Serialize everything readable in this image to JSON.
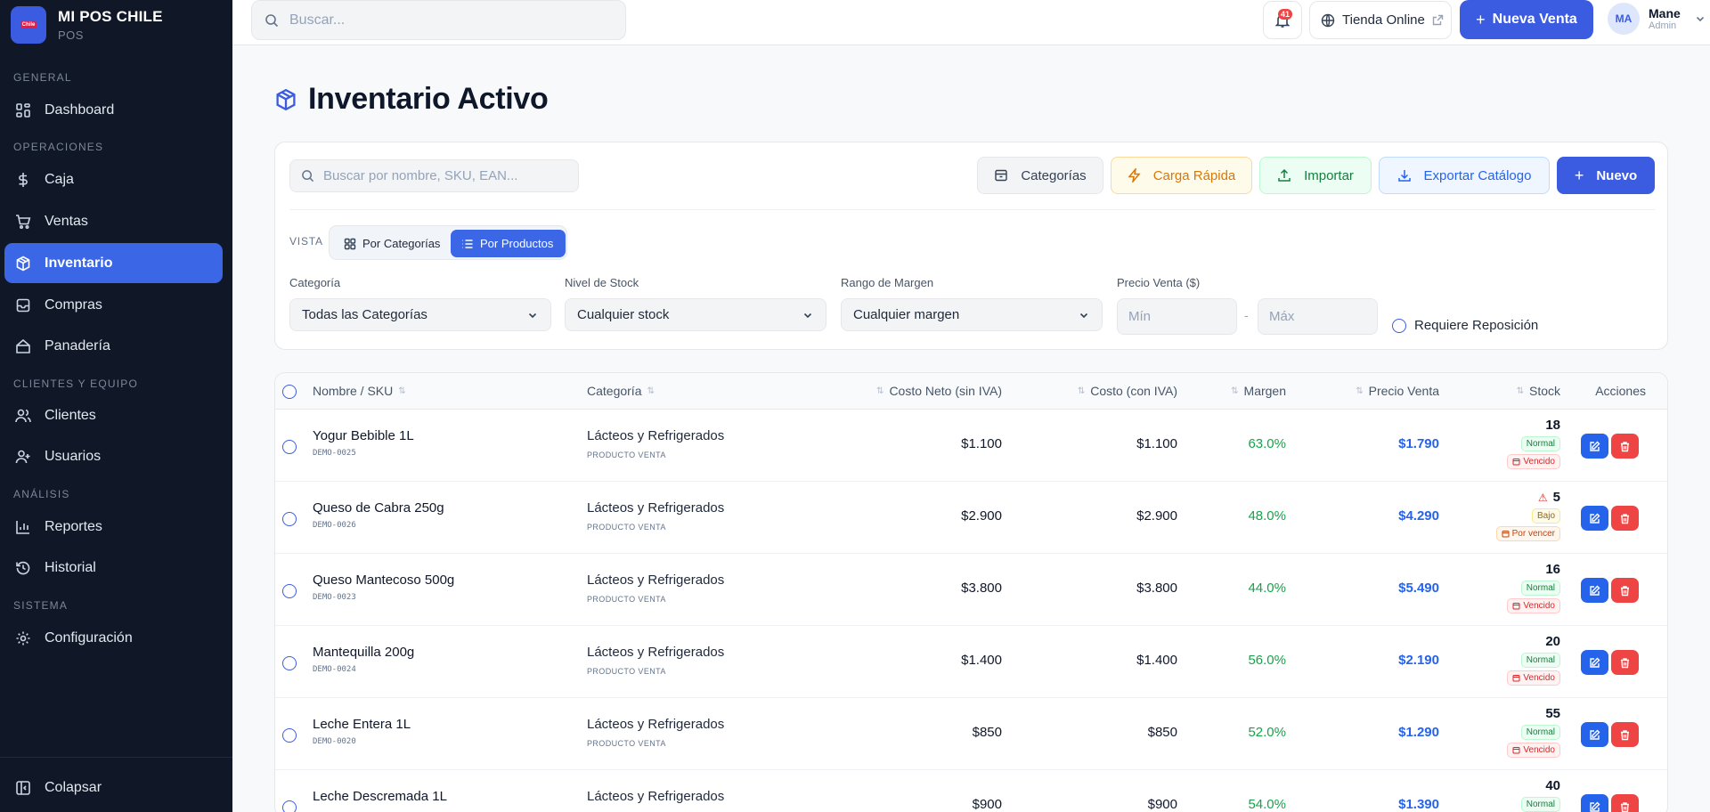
{
  "app": {
    "name": "MI POS CHILE",
    "subtitle": "POS",
    "logo_badge": "Chile"
  },
  "sidebar": {
    "sections": [
      {
        "label": "GENERAL"
      },
      {
        "label": "OPERACIONES"
      },
      {
        "label": "CLIENTES Y EQUIPO"
      },
      {
        "label": "ANÁLISIS"
      },
      {
        "label": "SISTEMA"
      }
    ],
    "items": [
      {
        "label": "Dashboard",
        "icon": "grid-icon"
      },
      {
        "label": "Caja",
        "icon": "dollar-icon"
      },
      {
        "label": "Ventas",
        "icon": "cart-icon"
      },
      {
        "label": "Inventario",
        "icon": "box-icon",
        "active": true
      },
      {
        "label": "Compras",
        "icon": "receipt-icon"
      },
      {
        "label": "Panadería",
        "icon": "home-icon"
      },
      {
        "label": "Clientes",
        "icon": "users-icon"
      },
      {
        "label": "Usuarios",
        "icon": "user-icon"
      },
      {
        "label": "Reportes",
        "icon": "bar-chart-icon"
      },
      {
        "label": "Historial",
        "icon": "history-icon"
      },
      {
        "label": "Configuración",
        "icon": "gear-icon"
      }
    ],
    "collapse_label": "Colapsar"
  },
  "topbar": {
    "search_placeholder": "Buscar...",
    "notification_count": "41",
    "store_label": "Tienda Online",
    "new_sale_label": "Nueva Venta",
    "user": {
      "initials": "MA",
      "name": "Mane",
      "role": "Admin"
    }
  },
  "page": {
    "title": "Inventario Activo"
  },
  "toolbar": {
    "search_placeholder": "Buscar por nombre, SKU, EAN...",
    "categories_label": "Categorías",
    "quick_load_label": "Carga Rápida",
    "import_label": "Importar",
    "export_label": "Exportar Catálogo",
    "new_label": "Nuevo"
  },
  "view": {
    "label": "VISTA",
    "by_categories": "Por Categorías",
    "by_products": "Por Productos",
    "selected": "Por Productos"
  },
  "filters": {
    "category": {
      "label": "Categoría",
      "value": "Todas las Categorías"
    },
    "stock_level": {
      "label": "Nivel de Stock",
      "value": "Cualquier stock"
    },
    "margin_range": {
      "label": "Rango de Margen",
      "value": "Cualquier margen"
    },
    "price": {
      "label": "Precio Venta ($)",
      "min_placeholder": "Mín",
      "max_placeholder": "Máx",
      "separator": "-"
    },
    "restock_label": "Requiere Reposición"
  },
  "table": {
    "columns": [
      "Nombre / SKU",
      "Categoría",
      "Costo Neto (sin IVA)",
      "Costo (con IVA)",
      "Margen",
      "Precio Venta",
      "Stock",
      "Acciones"
    ],
    "rows": [
      {
        "name": "Yogur Bebible 1L",
        "sku": "DEMO-0025",
        "category": "Lácteos y Refrigerados",
        "type": "PRODUCTO VENTA",
        "cost_net": "$1.100",
        "cost_iva": "$1.100",
        "margin": "63.0%",
        "price": "$1.790",
        "stock": "18",
        "level": "Normal",
        "expiry": "Vencido",
        "warn": ""
      },
      {
        "name": "Queso de Cabra 250g",
        "sku": "DEMO-0026",
        "category": "Lácteos y Refrigerados",
        "type": "PRODUCTO VENTA",
        "cost_net": "$2.900",
        "cost_iva": "$2.900",
        "margin": "48.0%",
        "price": "$4.290",
        "stock": "5",
        "level": "Bajo",
        "expiry": "Por vencer",
        "warn": "⚠"
      },
      {
        "name": "Queso Mantecoso 500g",
        "sku": "DEMO-0023",
        "category": "Lácteos y Refrigerados",
        "type": "PRODUCTO VENTA",
        "cost_net": "$3.800",
        "cost_iva": "$3.800",
        "margin": "44.0%",
        "price": "$5.490",
        "stock": "16",
        "level": "Normal",
        "expiry": "Vencido",
        "warn": ""
      },
      {
        "name": "Mantequilla 200g",
        "sku": "DEMO-0024",
        "category": "Lácteos y Refrigerados",
        "type": "PRODUCTO VENTA",
        "cost_net": "$1.400",
        "cost_iva": "$1.400",
        "margin": "56.0%",
        "price": "$2.190",
        "stock": "20",
        "level": "Normal",
        "expiry": "Vencido",
        "warn": ""
      },
      {
        "name": "Leche Entera 1L",
        "sku": "DEMO-0020",
        "category": "Lácteos y Refrigerados",
        "type": "PRODUCTO VENTA",
        "cost_net": "$850",
        "cost_iva": "$850",
        "margin": "52.0%",
        "price": "$1.290",
        "stock": "55",
        "level": "Normal",
        "expiry": "Vencido",
        "warn": ""
      },
      {
        "name": "Leche Descremada 1L",
        "sku": "",
        "category": "Lácteos y Refrigerados",
        "type": "",
        "cost_net": "$900",
        "cost_iva": "$900",
        "margin": "54.0%",
        "price": "$1.390",
        "stock": "40",
        "level": "Normal",
        "expiry": "",
        "warn": ""
      }
    ]
  },
  "colors": {
    "accent": "#3b5ce0",
    "sidebar_bg": "#101727",
    "margin_green": "#16a34a",
    "price_blue": "#2563eb",
    "danger": "#ef4444"
  }
}
